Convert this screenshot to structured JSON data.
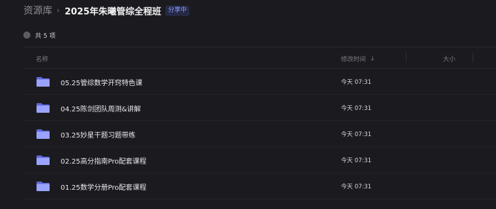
{
  "breadcrumb": {
    "root": "资源库",
    "separator": "›",
    "title": "2025年朱曦管综全程班",
    "badge": "分享中"
  },
  "summary": {
    "count_text": "共 5 项"
  },
  "table": {
    "columns": {
      "name": "名称",
      "modified": "修改时间",
      "size": "大小"
    },
    "sort_indicator": "↓",
    "rows": [
      {
        "name": "05.25管综数学开窍特色课",
        "modified": "今天 07:31"
      },
      {
        "name": "04.25陈剑团队周测&讲解",
        "modified": "今天 07:31"
      },
      {
        "name": "03.25妙星干题习题带练",
        "modified": "今天 07:31"
      },
      {
        "name": "02.25高分指南Pro配套课程",
        "modified": "今天 07:31"
      },
      {
        "name": "01.25数学分册Pro配套课程",
        "modified": "今天 07:31"
      }
    ]
  },
  "colors": {
    "background": "#1b1b1f",
    "accent": "#8e9bff",
    "folder_back": "#5e66d6",
    "folder_front": "#9aa3ff"
  }
}
